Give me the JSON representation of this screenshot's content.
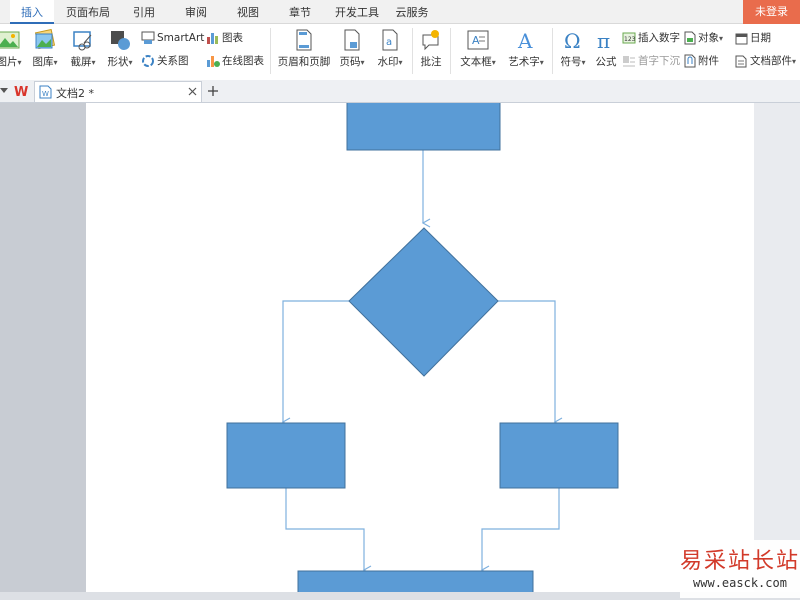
{
  "menu": {
    "tabs": [
      "插入",
      "页面布局",
      "引用",
      "审阅",
      "视图",
      "章节",
      "开发工具",
      "云服务"
    ],
    "active": "插入",
    "login": "未登录"
  },
  "ribbon": {
    "picture": "图片",
    "gallery": "图库",
    "screenshot": "截屏",
    "shapes": "形状",
    "smartart": "SmartArt",
    "relation": "关系图",
    "chart": "图表",
    "online_chart": "在线图表",
    "header_footer": "页眉和页脚",
    "page_number": "页码",
    "watermark": "水印",
    "comment": "批注",
    "textbox": "文本框",
    "wordart": "艺术字",
    "symbol": "符号",
    "formula": "公式",
    "insert_number": "插入数字",
    "object": "对象",
    "date": "日期",
    "drop_cap": "首字下沉",
    "attachment": "附件",
    "doc_parts": "文档部件"
  },
  "document_tab": {
    "name": "文档2 *"
  },
  "watermark": {
    "title": "易采站长站",
    "url": "www.easck.com"
  },
  "colors": {
    "shape_fill": "#5b9bd5",
    "shape_stroke": "#41719c",
    "connector": "#7eb0de",
    "accent": "#2f6db8",
    "login_bg": "#e96c4c"
  }
}
